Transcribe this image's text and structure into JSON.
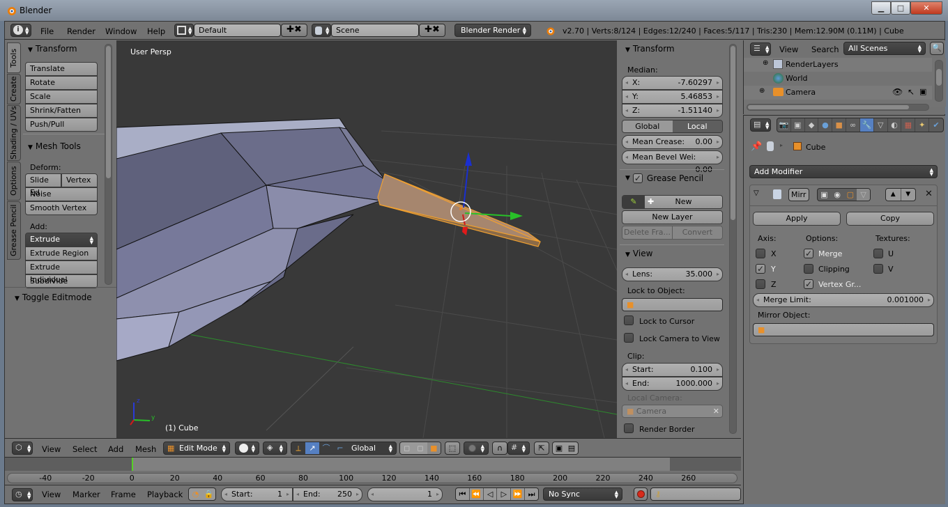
{
  "window": {
    "title": "Blender",
    "controls": {
      "minimize": "minimize-icon",
      "maximize": "maximize-icon",
      "close": "close-icon"
    }
  },
  "info_header": {
    "menus": [
      "File",
      "Render",
      "Window",
      "Help"
    ],
    "screen_layout": "Default",
    "scene": "Scene",
    "render_engine": "Blender Render",
    "stats": "v2.70 | Verts:8/124 | Edges:12/240 | Faces:5/117 | Tris:230 | Mem:12.90M (0.11M) | Cube"
  },
  "tool_shelf": {
    "tabs": [
      "Tools",
      "Create",
      "Shading / UVs",
      "Options",
      "Grease Pencil"
    ],
    "active_tab": "Tools",
    "transform": {
      "title": "Transform",
      "buttons": [
        "Translate",
        "Rotate",
        "Scale",
        "Shrink/Fatten",
        "Push/Pull"
      ]
    },
    "mesh_tools": {
      "title": "Mesh Tools",
      "deform_label": "Deform:",
      "deform_row": [
        "Slide Ed",
        "Vertex"
      ],
      "deform_buttons": [
        "Noise",
        "Smooth Vertex"
      ],
      "add_label": "Add:",
      "extrude_dropdown": "Extrude",
      "add_buttons": [
        "Extrude Region",
        "Extrude Individual",
        "Subdivide"
      ]
    },
    "operator_panel": "Toggle Editmode"
  },
  "viewport": {
    "view_name": "User Persp",
    "object_label": "(1) Cube",
    "axis_labels": {
      "x": "x",
      "y": "y",
      "z": "z"
    }
  },
  "properties_shelf": {
    "transform": {
      "title": "Transform",
      "median_label": "Median:",
      "x_label": "X:",
      "x_value": "-7.60297",
      "y_label": "Y:",
      "y_value": "5.46853",
      "z_label": "Z:",
      "z_value": "-1.51140",
      "space_options": [
        "Global",
        "Local"
      ],
      "active_space": "Local",
      "mean_crease_label": "Mean Crease:",
      "mean_crease_value": "0.00",
      "mean_bevel_label": "Mean Bevel Wei:",
      "mean_bevel_value": "0.00"
    },
    "grease_pencil": {
      "title": "Grease Pencil",
      "enabled": true,
      "new_label": "New",
      "new_layer_label": "New Layer",
      "delete_frame_label": "Delete Fra...",
      "convert_label": "Convert"
    },
    "view": {
      "title": "View",
      "lens_label": "Lens:",
      "lens_value": "35.000",
      "lock_object_label": "Lock to Object:",
      "lock_to_cursor": {
        "label": "Lock to Cursor",
        "checked": false
      },
      "lock_camera_to_view": {
        "label": "Lock Camera to View",
        "checked": false
      },
      "clip_label": "Clip:",
      "clip_start_label": "Start:",
      "clip_start_value": "0.100",
      "clip_end_label": "End:",
      "clip_end_value": "1000.000",
      "local_camera_label": "Local Camera:",
      "local_camera_value": "Camera",
      "render_border": {
        "label": "Render Border",
        "checked": false
      }
    }
  },
  "outliner": {
    "menus": [
      "View",
      "Search"
    ],
    "filter": "All Scenes",
    "items": [
      {
        "name": "RenderLayers",
        "icon": "render-layers-icon"
      },
      {
        "name": "World",
        "icon": "world-icon"
      },
      {
        "name": "Camera",
        "icon": "camera-object-icon"
      }
    ]
  },
  "properties_editor": {
    "tabs": [
      "render-icon",
      "render-layers-icon",
      "scene-icon",
      "world-icon",
      "object-icon",
      "constraints-icon",
      "modifiers-icon",
      "data-icon",
      "material-icon",
      "texture-icon",
      "particles-icon",
      "physics-icon"
    ],
    "active_tab": "modifiers-icon",
    "breadcrumb_object": "Cube",
    "add_modifier_label": "Add Modifier",
    "modifier": {
      "name": "Mirr",
      "apply_label": "Apply",
      "copy_label": "Copy",
      "axis_label": "Axis:",
      "options_label": "Options:",
      "textures_label": "Textures:",
      "axis": [
        {
          "label": "X",
          "checked": false
        },
        {
          "label": "Y",
          "checked": true
        },
        {
          "label": "Z",
          "checked": false
        }
      ],
      "options": [
        {
          "label": "Merge",
          "checked": true
        },
        {
          "label": "Clipping",
          "checked": false
        },
        {
          "label": "Vertex Gr...",
          "checked": true
        }
      ],
      "textures": [
        {
          "label": "U",
          "checked": false
        },
        {
          "label": "V",
          "checked": false
        }
      ],
      "merge_limit_label": "Merge Limit:",
      "merge_limit_value": "0.001000",
      "mirror_object_label": "Mirror Object:"
    }
  },
  "view3d_header": {
    "menus": [
      "View",
      "Select",
      "Add",
      "Mesh"
    ],
    "mode": "Edit Mode",
    "transform_orientation": "Global"
  },
  "timeline": {
    "ticks": [
      "-40",
      "-20",
      "0",
      "20",
      "40",
      "60",
      "80",
      "100",
      "120",
      "140",
      "160",
      "180",
      "200",
      "220",
      "240",
      "260"
    ],
    "current_frame_marker": 0
  },
  "timeline_header": {
    "menus": [
      "View",
      "Marker",
      "Frame",
      "Playback"
    ],
    "start_label": "Start:",
    "start_value": "1",
    "end_label": "End:",
    "end_value": "250",
    "current_frame": "1",
    "sync": "No Sync"
  }
}
